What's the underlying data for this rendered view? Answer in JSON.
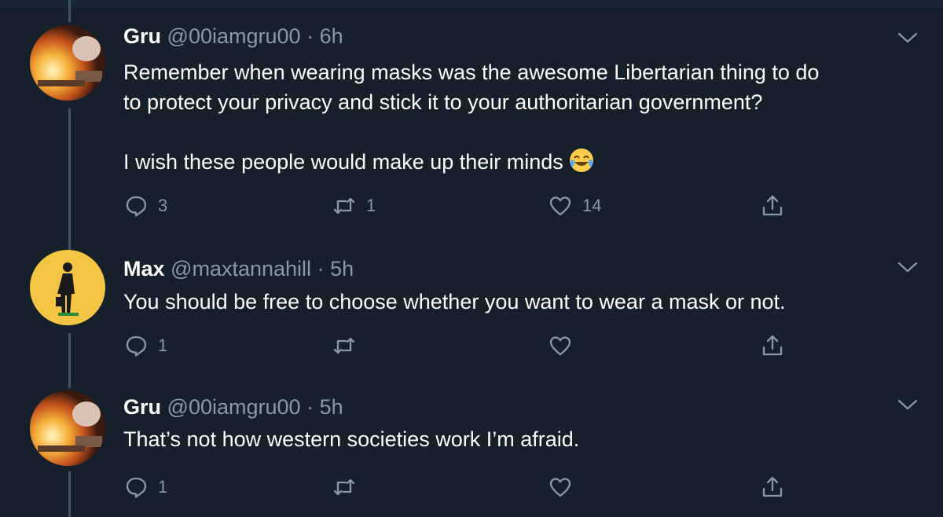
{
  "tweets": [
    {
      "name": "Gru",
      "handle": "@00iamgru00",
      "dot": "·",
      "time": "6h",
      "text": "Remember when wearing masks was the awesome Libertarian thing to do\nto protect your privacy and stick it to your authoritarian government?\n\nI wish these people would make up their minds",
      "emoji_icon": "face-with-tears-of-joy-icon",
      "replies": "3",
      "retweets": "1",
      "likes": "14"
    },
    {
      "name": "Max",
      "handle": "@maxtannahill",
      "dot": "·",
      "time": "5h",
      "text": "You should be free to choose whether you want to wear a mask or not.",
      "replies": "1",
      "retweets": "",
      "likes": ""
    },
    {
      "name": "Gru",
      "handle": "@00iamgru00",
      "dot": "·",
      "time": "5h",
      "text": "That’s not how western societies work I’m afraid.",
      "replies": "1",
      "retweets": "",
      "likes": ""
    }
  ],
  "colors": {
    "background": "#15202b",
    "secondary_text": "#8899a6",
    "thread_line": "#3d5466"
  },
  "icons": [
    "reply-icon",
    "retweet-icon",
    "like-icon",
    "share-icon",
    "chevron-down-icon"
  ]
}
